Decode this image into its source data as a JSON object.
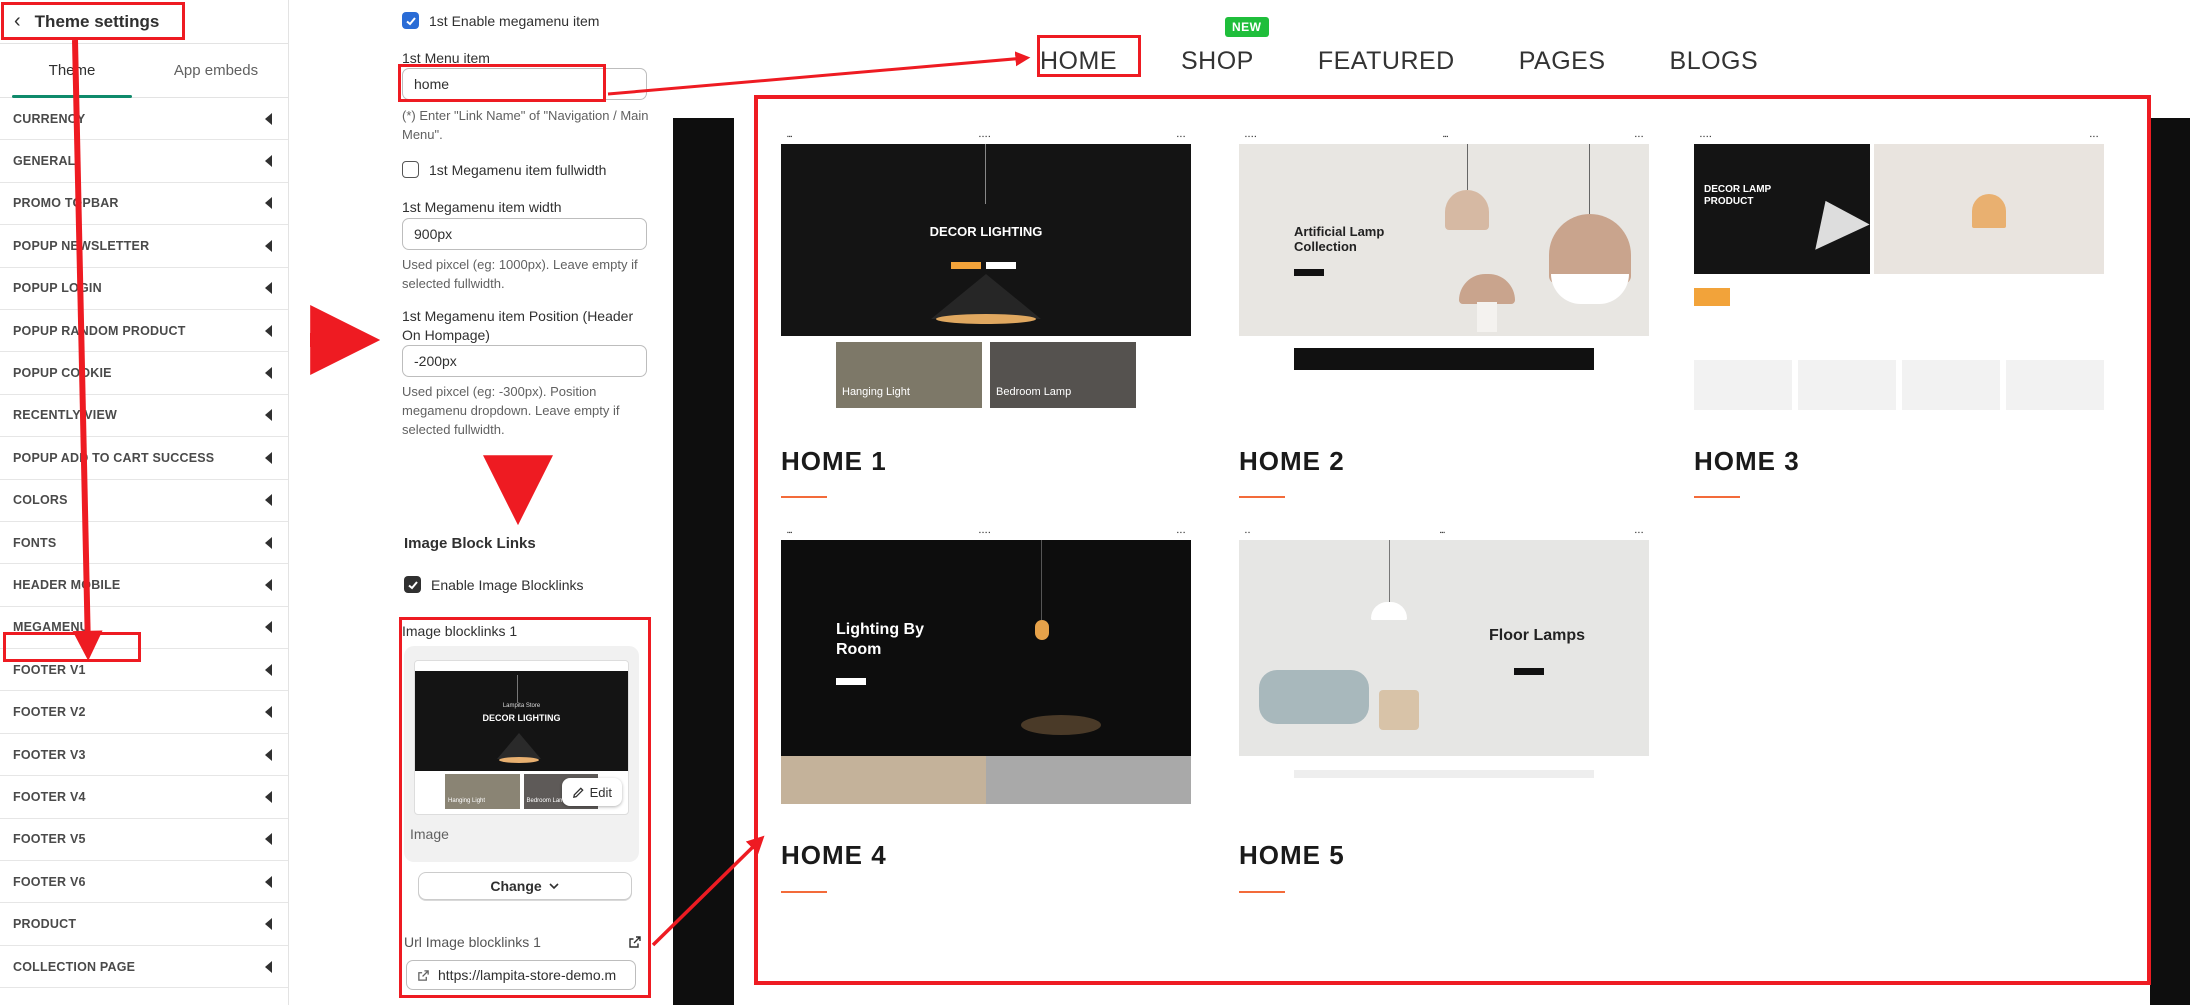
{
  "sidebar": {
    "title": "Theme settings",
    "tabs": [
      {
        "label": "Theme",
        "active": true
      },
      {
        "label": "App embeds",
        "active": false
      }
    ],
    "items": [
      "CURRENCY",
      "GENERAL",
      "PROMO TOPBAR",
      "POPUP NEWSLETTER",
      "POPUP LOGIN",
      "POPUP RANDOM PRODUCT",
      "POPUP COOKIE",
      "RECENTLY VIEW",
      "POPUP ADD TO CART SUCCESS",
      "COLORS",
      "FONTS",
      "HEADER MOBILE",
      "MEGAMENU",
      "FOOTER V1",
      "FOOTER V2",
      "FOOTER V3",
      "FOOTER V4",
      "FOOTER V5",
      "FOOTER V6",
      "PRODUCT",
      "COLLECTION PAGE"
    ]
  },
  "panel": {
    "enable_item_label": "1st Enable megamenu item",
    "menu_item_label": "1st Menu item",
    "menu_item_value": "home",
    "menu_item_help": "(*) Enter \"Link Name\" of \"Navigation / Main Menu\".",
    "fullwidth_label": "1st Megamenu item fullwidth",
    "width_label": "1st Megamenu item width",
    "width_value": "900px",
    "width_help": "Used pixcel (eg: 1000px). Leave empty if selected fullwidth.",
    "position_label": "1st Megamenu item Position (Header On Hompage)",
    "position_value": "-200px",
    "position_help": "Used pixcel (eg: -300px). Position megamenu dropdown. Leave empty if selected fullwidth.",
    "section_title": "Image Block Links",
    "enable_blocklinks_label": "Enable Image Blocklinks",
    "blocklinks_title": "Image blocklinks 1",
    "image_caption": "Image",
    "edit_label": "Edit",
    "change_label": "Change",
    "url_label": "Url Image blocklinks 1",
    "url_value": "https://lampita-store-demo.m"
  },
  "preview": {
    "nav": [
      {
        "label": "HOME",
        "badge": ""
      },
      {
        "label": "SHOP",
        "badge": "NEW"
      },
      {
        "label": "FEATURED",
        "badge": ""
      },
      {
        "label": "PAGES",
        "badge": ""
      },
      {
        "label": "BLOGS",
        "badge": ""
      }
    ],
    "tiles": [
      {
        "title": "HOME 1",
        "hero": "DECOR LIGHTING",
        "subs": [
          "Hanging Light",
          "Bedroom Lamp"
        ]
      },
      {
        "title": "HOME 2",
        "hero": "Artificial Lamp Collection"
      },
      {
        "title": "HOME 3",
        "hero": "DECOR LAMP PRODUCT"
      },
      {
        "title": "HOME 4",
        "hero": "Lighting By Room"
      },
      {
        "title": "HOME 5",
        "hero": "Floor Lamps"
      }
    ],
    "thumb_text": {
      "store": "Lampita Store",
      "hero": "DECOR LIGHTING",
      "subs": [
        "Hanging Light",
        "Bedroom Lamp"
      ]
    }
  },
  "colors": {
    "annotation_red": "#ee1b22",
    "checkbox_blue": "#2a6cd6",
    "tab_accent": "#0f8a6b",
    "new_badge": "#1fbe3b",
    "underline_orange": "#f36b3a"
  }
}
